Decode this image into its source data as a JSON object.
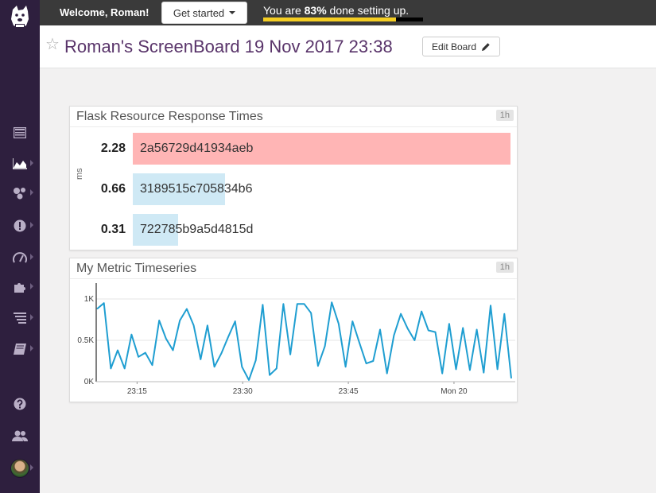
{
  "nav": {
    "items": [
      {
        "name": "nav-events-icon",
        "glyph": "events"
      },
      {
        "name": "nav-dashboards-icon",
        "glyph": "chart"
      },
      {
        "name": "nav-infrastructure-icon",
        "glyph": "hex"
      },
      {
        "name": "nav-monitors-icon",
        "glyph": "alert"
      },
      {
        "name": "nav-apm-icon",
        "glyph": "gauge"
      },
      {
        "name": "nav-integrations-icon",
        "glyph": "puzzle"
      },
      {
        "name": "nav-logs-icon",
        "glyph": "list"
      },
      {
        "name": "nav-notebooks-icon",
        "glyph": "book"
      }
    ]
  },
  "topbar": {
    "welcome": "Welcome, Roman!",
    "get_started": "Get started",
    "progress_prefix": "You are ",
    "progress_percent": "83%",
    "progress_suffix": " done setting up.",
    "progress_value": 0.83
  },
  "header": {
    "title": "Roman's ScreenBoard 19 Nov 2017 23:38",
    "edit_button": "Edit Board"
  },
  "toplist": {
    "title": "Flask Resource Response Times",
    "timeframe": "1h",
    "unit": "ms",
    "rows": [
      {
        "value": "2.28",
        "label": "2a56729d41934aeb",
        "fraction": 1.0,
        "color": "#ffb5b5"
      },
      {
        "value": "0.66",
        "label": "3189515c705834b6",
        "fraction": 0.244,
        "color": "#cfe9f5"
      },
      {
        "value": "0.31",
        "label": "722785b9a5d4815d",
        "fraction": 0.12,
        "color": "#cfe9f5"
      }
    ]
  },
  "timeseries": {
    "title": "My Metric Timeseries",
    "timeframe": "1h",
    "chart_data": {
      "type": "line",
      "series_color": "#1f9ed1",
      "ylim": [
        0,
        1000
      ],
      "yticks": [
        {
          "value": 0,
          "label": "0K"
        },
        {
          "value": 500,
          "label": "0.5K"
        },
        {
          "value": 1000,
          "label": "1K"
        }
      ],
      "xticks": [
        {
          "t": 15,
          "label": "23:15"
        },
        {
          "t": 30,
          "label": "23:30"
        },
        {
          "t": 45,
          "label": "23:45"
        },
        {
          "t": 60,
          "label": "Mon 20"
        }
      ],
      "xlim": [
        9.2,
        68.7
      ],
      "values": [
        880,
        950,
        160,
        380,
        160,
        570,
        300,
        350,
        200,
        740,
        520,
        380,
        740,
        880,
        680,
        270,
        680,
        180,
        340,
        540,
        730,
        180,
        20,
        260,
        930,
        80,
        160,
        940,
        330,
        940,
        940,
        830,
        190,
        430,
        960,
        700,
        180,
        730,
        470,
        220,
        250,
        630,
        100,
        560,
        820,
        640,
        500,
        850,
        620,
        600,
        100,
        700,
        150,
        650,
        140,
        630,
        110,
        920,
        150,
        820,
        40
      ]
    }
  }
}
